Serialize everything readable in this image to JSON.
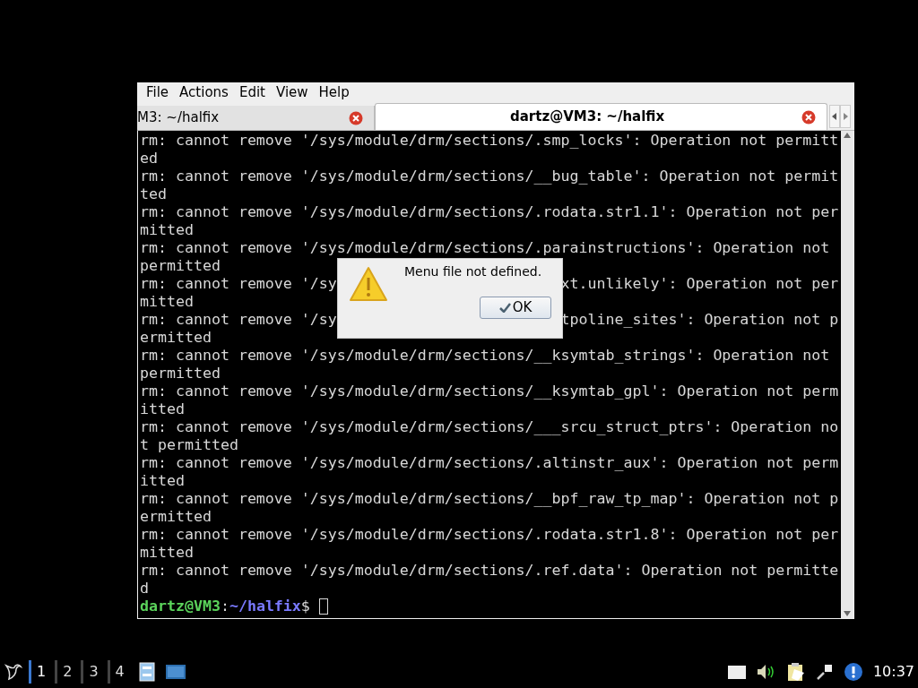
{
  "window": {
    "menu": [
      "File",
      "Actions",
      "Edit",
      "View",
      "Help"
    ],
    "tabs": [
      {
        "title": "M3: ~/halfix",
        "selected": false
      },
      {
        "title": "dartz@VM3: ~/halfix",
        "selected": true
      }
    ],
    "terminal": {
      "lines": [
        {
          "kind": "full",
          "text": "rm: cannot remove '/sys/module/drm/sections/.smp_locks': Operation not permitt"
        },
        {
          "kind": "full",
          "text": "ed"
        },
        {
          "kind": "full",
          "text": "rm: cannot remove '/sys/module/drm/sections/__bug_table': Operation not permit"
        },
        {
          "kind": "full",
          "text": "ted"
        },
        {
          "kind": "full",
          "text": "rm: cannot remove '/sys/module/drm/sections/.rodata.str1.1': Operation not per"
        },
        {
          "kind": "full",
          "text": "mitted"
        },
        {
          "kind": "full",
          "text": "rm: cannot remove '/sys/module/drm/sections/.parainstructions': Operation not"
        },
        {
          "kind": "full",
          "text": "permitted"
        },
        {
          "kind": "covered",
          "left": "rm: cannot remove '/sy",
          "right": "xt.unlikely': Operation not per"
        },
        {
          "kind": "full",
          "text": "mitted"
        },
        {
          "kind": "covered",
          "left": "rm: cannot remove '/sy",
          "right": "tpoline_sites': Operation not p"
        },
        {
          "kind": "full",
          "text": "ermitted"
        },
        {
          "kind": "full",
          "text": "rm: cannot remove '/sys/module/drm/sections/__ksymtab_strings': Operation not"
        },
        {
          "kind": "full",
          "text": "permitted"
        },
        {
          "kind": "full",
          "text": "rm: cannot remove '/sys/module/drm/sections/__ksymtab_gpl': Operation not perm"
        },
        {
          "kind": "full",
          "text": "itted"
        },
        {
          "kind": "full",
          "text": "rm: cannot remove '/sys/module/drm/sections/___srcu_struct_ptrs': Operation no"
        },
        {
          "kind": "full",
          "text": "t permitted"
        },
        {
          "kind": "full",
          "text": "rm: cannot remove '/sys/module/drm/sections/.altinstr_aux': Operation not perm"
        },
        {
          "kind": "full",
          "text": "itted"
        },
        {
          "kind": "full",
          "text": "rm: cannot remove '/sys/module/drm/sections/__bpf_raw_tp_map': Operation not p"
        },
        {
          "kind": "full",
          "text": "ermitted"
        },
        {
          "kind": "full",
          "text": "rm: cannot remove '/sys/module/drm/sections/.rodata.str1.8': Operation not per"
        },
        {
          "kind": "full",
          "text": "mitted"
        },
        {
          "kind": "full",
          "text": "rm: cannot remove '/sys/module/drm/sections/.ref.data': Operation not permitte"
        },
        {
          "kind": "full",
          "text": "d"
        }
      ],
      "prompt": {
        "user_host": "dartz@VM3",
        "separator": ":",
        "path": "~/halfix",
        "symbol": "$"
      }
    }
  },
  "dialog": {
    "message": "Menu file not defined.",
    "button": "OK"
  },
  "taskbar": {
    "workspaces": [
      {
        "label": "1",
        "selected": true
      },
      {
        "label": "2",
        "selected": false
      },
      {
        "label": "3",
        "selected": false
      },
      {
        "label": "4",
        "selected": false
      }
    ],
    "clock": "10:37"
  }
}
